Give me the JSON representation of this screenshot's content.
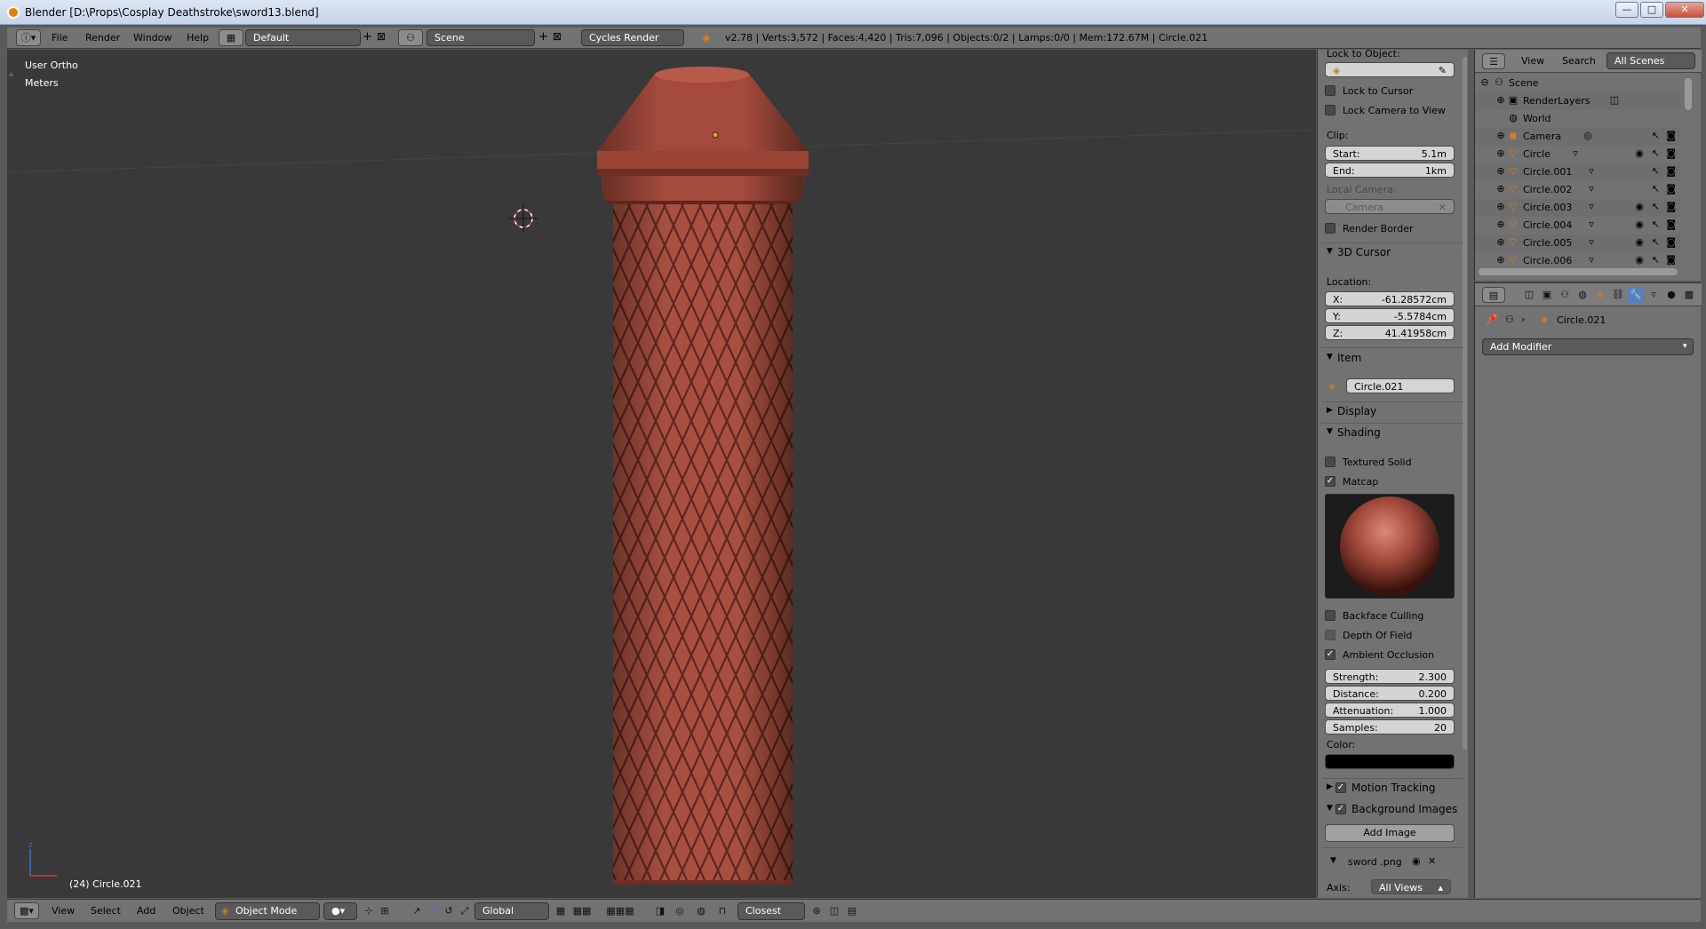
{
  "window": {
    "title": "Blender [D:\\Props\\Cosplay Deathstroke\\sword13.blend]",
    "min_label": "—",
    "max_label": "□",
    "close_label": "✕"
  },
  "menu": {
    "file": "File",
    "render": "Render",
    "window": "Window",
    "help": "Help",
    "layout": "Default",
    "scene": "Scene",
    "engine": "Cycles Render",
    "info": "v2.78 | Verts:3,572 | Faces:4,420 | Tris:7,096 | Objects:0/2 | Lamps:0/0 | Mem:172.67M | Circle.021"
  },
  "viewport": {
    "view_name": "User Ortho",
    "units": "Meters",
    "object_label": "(24) Circle.021"
  },
  "npanel": {
    "lock_to_object": "Lock to Object:",
    "lock_to_cursor": "Lock to Cursor",
    "lock_camera": "Lock Camera to View",
    "clip": "Clip:",
    "start_label": "Start:",
    "start_value": "5.1m",
    "end_label": "End:",
    "end_value": "1km",
    "local_camera": "Local Camera:",
    "camera_value": "Camera",
    "render_border": "Render Border",
    "cursor_header": "3D Cursor",
    "location": "Location:",
    "x_label": "X:",
    "x_value": "-61.28572cm",
    "y_label": "Y:",
    "y_value": "-5.5784cm",
    "z_label": "Z:",
    "z_value": "41.41958cm",
    "item_header": "Item",
    "item_name": "Circle.021",
    "display_header": "Display",
    "shading_header": "Shading",
    "textured_solid": "Textured Solid",
    "matcap": "Matcap",
    "backface": "Backface Culling",
    "dof": "Depth Of Field",
    "ao": "Ambient Occlusion",
    "strength_label": "Strength:",
    "strength_value": "2.300",
    "distance_label": "Distance:",
    "distance_value": "0.200",
    "attenuation_label": "Attenuation:",
    "attenuation_value": "1.000",
    "samples_label": "Samples:",
    "samples_value": "20",
    "color_label": "Color:",
    "motion_tracking": "Motion Tracking",
    "bg_images": "Background Images",
    "add_image": "Add Image",
    "image_name": "sword .png",
    "axis_label": "Axis:",
    "axis_value": "All Views"
  },
  "outliner": {
    "view": "View",
    "search": "Search",
    "all_scenes": "All Scenes",
    "items": [
      {
        "name": "Scene"
      },
      {
        "name": "RenderLayers"
      },
      {
        "name": "World"
      },
      {
        "name": "Camera"
      },
      {
        "name": "Circle"
      },
      {
        "name": "Circle.001"
      },
      {
        "name": "Circle.002"
      },
      {
        "name": "Circle.003"
      },
      {
        "name": "Circle.004"
      },
      {
        "name": "Circle.005"
      },
      {
        "name": "Circle.006"
      }
    ]
  },
  "properties": {
    "object_name": "Circle.021",
    "add_modifier": "Add Modifier"
  },
  "bottombar": {
    "view": "View",
    "select": "Select",
    "add": "Add",
    "object": "Object",
    "mode": "Object Mode",
    "orientation": "Global",
    "snap": "Closest"
  },
  "colors": {
    "mesh": "#a34a3c",
    "accent": "#5680c2",
    "viewport_bg": "#393939"
  }
}
